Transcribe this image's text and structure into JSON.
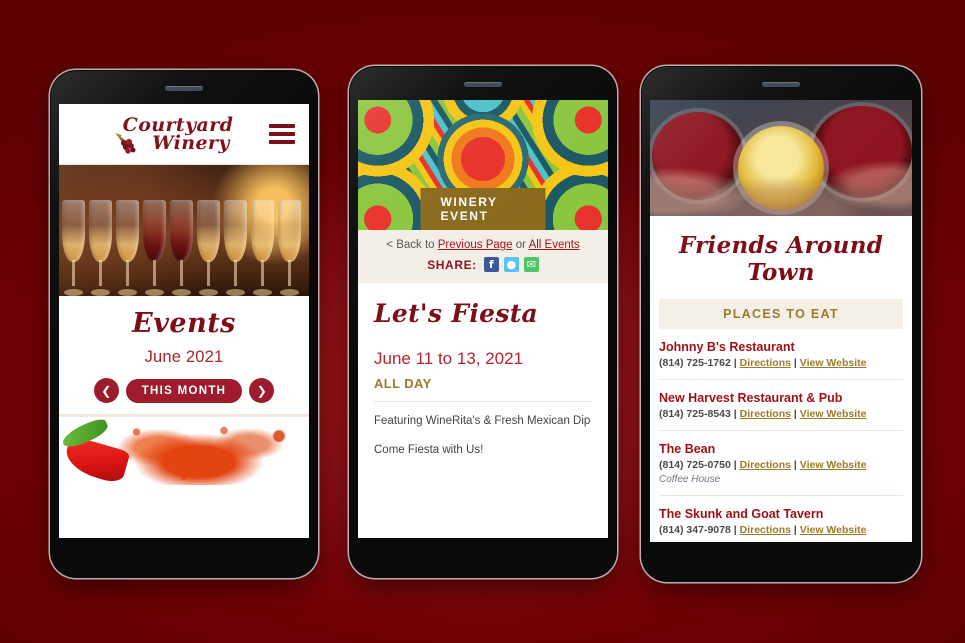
{
  "theme": {
    "background_red": "#8e1015",
    "brand_dark_red": "#7d0d16",
    "brand_crimson": "#9e1b2b",
    "brand_gold": "#9e7b2a",
    "badge_gold": "#8a6a1d",
    "cream": "#f4efe6"
  },
  "phone1": {
    "logo": {
      "line1": "Courtyard",
      "line2": "Winery",
      "icon": "grape-cluster-icon"
    },
    "menu_icon": "hamburger-menu-icon",
    "hero_image": "row-of-wine-glasses-photo",
    "events": {
      "title": "Events",
      "month": "June 2021",
      "prev_icon": "chevron-left-icon",
      "next_icon": "chevron-right-icon",
      "this_month_label": "THIS MONTH"
    },
    "event_image": "red-chili-pepper-and-paprika-photo"
  },
  "phone2": {
    "hero_image": "colorful-mexican-mandala-pattern",
    "badge": "WINERY EVENT",
    "back": {
      "prefix": "< Back to",
      "previous_page": "Previous Page",
      "or": "or",
      "all_events": "All Events"
    },
    "share": {
      "label": "SHARE:",
      "facebook_icon": "facebook-icon",
      "twitter_icon": "twitter-icon",
      "email_icon": "email-icon"
    },
    "event": {
      "name": "Let's Fiesta",
      "date": "June 11 to 13, 2021",
      "time": "ALL DAY",
      "description_1": "Featuring WineRita's & Fresh Mexican Dip",
      "description_2": "Come Fiesta with Us!"
    }
  },
  "phone3": {
    "hero_image": "wine-glasses-toasting-photo",
    "heading": "Friends Around Town",
    "section_label": "PLACES TO EAT",
    "listings": [
      {
        "name": "Johnny B's Restaurant",
        "phone": "(814) 725-1762",
        "directions": "Directions",
        "website": "View Website",
        "subtitle": ""
      },
      {
        "name": "New Harvest Restaurant & Pub",
        "phone": "(814) 725-8543",
        "directions": "Directions",
        "website": "View Website",
        "subtitle": ""
      },
      {
        "name": "The Bean",
        "phone": "(814) 725-0750",
        "directions": "Directions",
        "website": "View Website",
        "subtitle": "Coffee House"
      },
      {
        "name": "The Skunk and Goat Tavern",
        "phone": "(814) 347-9078",
        "directions": "Directions",
        "website": "View Website",
        "subtitle": ""
      }
    ],
    "separator": "|"
  }
}
